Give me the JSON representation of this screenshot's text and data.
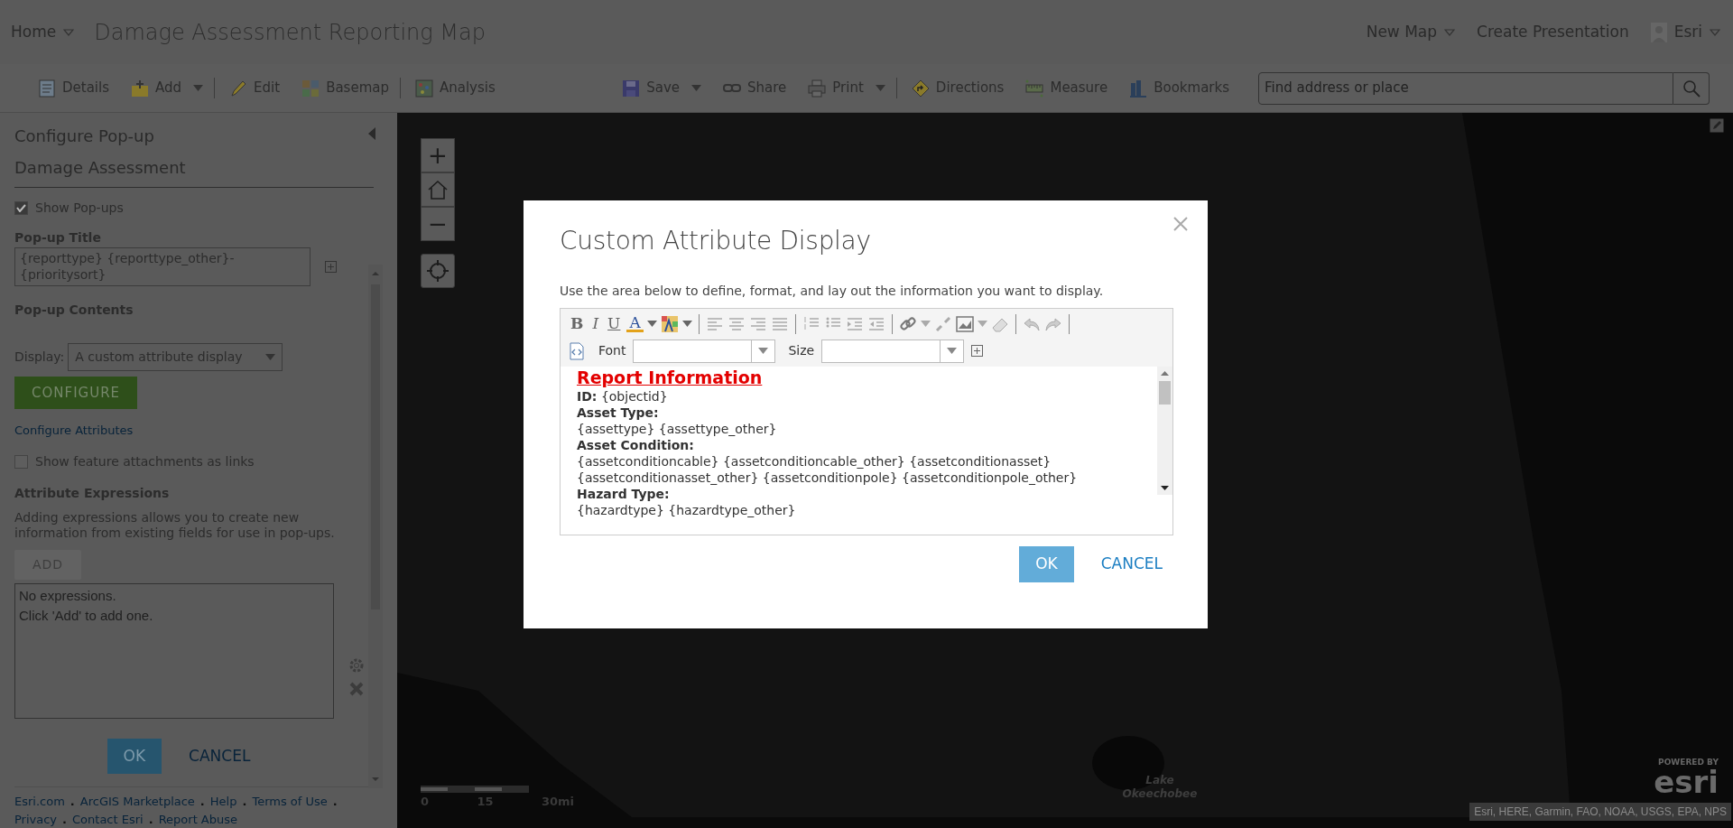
{
  "header": {
    "home": "Home",
    "title": "Damage Assessment Reporting Map",
    "links": [
      {
        "label": "New Map",
        "dropdown": true
      },
      {
        "label": "Create Presentation",
        "dropdown": false
      }
    ],
    "user": "Esri"
  },
  "toolbar": {
    "items": [
      {
        "kind": "details",
        "label": "Details",
        "dropdown": false,
        "divider_after": false
      },
      {
        "kind": "add",
        "label": "Add",
        "dropdown": true,
        "divider_after": true
      },
      {
        "kind": "edit",
        "label": "Edit",
        "dropdown": false,
        "divider_after": false
      },
      {
        "kind": "basemap",
        "label": "Basemap",
        "dropdown": false,
        "divider_after": true
      },
      {
        "kind": "analysis",
        "label": "Analysis",
        "dropdown": false,
        "divider_after": false
      },
      {
        "kind": "spacer"
      },
      {
        "kind": "save",
        "label": "Save",
        "dropdown": true,
        "divider_after": false
      },
      {
        "kind": "share",
        "label": "Share",
        "dropdown": false,
        "divider_after": false
      },
      {
        "kind": "print",
        "label": "Print",
        "dropdown": true,
        "divider_after": true
      },
      {
        "kind": "directions",
        "label": "Directions",
        "dropdown": false,
        "divider_after": false
      },
      {
        "kind": "measure",
        "label": "Measure",
        "dropdown": false,
        "divider_after": false
      },
      {
        "kind": "bookmarks",
        "label": "Bookmarks",
        "dropdown": false,
        "divider_after": false
      }
    ],
    "search": {
      "placeholder": "Find address or place"
    }
  },
  "left_panel": {
    "title": "Configure Pop-up",
    "layer": "Damage Assessment",
    "show_popups": {
      "label": "Show Pop-ups",
      "checked": true
    },
    "popup_title": {
      "label": "Pop-up Title",
      "value": "{reporttype} {reporttype_other}-{prioritysort}"
    },
    "contents_label": "Pop-up Contents",
    "display": {
      "label": "Display:",
      "value": "A custom attribute display"
    },
    "configure_button": "CONFIGURE",
    "configure_link": "Configure Attributes",
    "show_attachments": {
      "label": "Show feature attachments as links",
      "checked": false
    },
    "expressions": {
      "heading": "Attribute Expressions",
      "description": "Adding expressions allows you to create new information from existing fields for use in pop-ups.",
      "add_button": "ADD",
      "list_lines": [
        "No expressions.",
        "Click 'Add' to add one."
      ]
    },
    "ok": "OK",
    "cancel": "CANCEL",
    "footer_separator": ".",
    "footer_links": [
      "Esri.com",
      "ArcGIS Marketplace",
      "Help",
      "Terms of Use",
      "Privacy",
      "Contact Esri",
      "Report Abuse"
    ]
  },
  "map": {
    "zoom_in": "+",
    "zoom_out": "−",
    "scale_labels": [
      "0",
      "15",
      "30mi"
    ],
    "lake_label": "Lake Okeechobee",
    "attribution": "Esri, HERE, Garmin, FAO, NOAA, USGS, EPA, NPS",
    "powered_by": "POWERED BY",
    "logo": "esri"
  },
  "modal": {
    "title": "Custom Attribute Display",
    "description": "Use the area below to define, format, and lay out the information you want to display.",
    "format_buttons": [
      "B",
      "I",
      "U",
      "A"
    ],
    "font_label": "Font",
    "size_label": "Size",
    "lines": [
      {
        "kind": "heading",
        "text": "Report Information"
      },
      {
        "kind": "value",
        "text": "**ID:** {objectid}"
      },
      {
        "kind": "label",
        "text": "Asset Type:"
      },
      {
        "kind": "value",
        "text": "{assettype} {assettype_other}"
      },
      {
        "kind": "label",
        "text": "Asset Condition:"
      },
      {
        "kind": "value",
        "text": "{assetconditioncable} {assetconditioncable_other} {assetconditionasset} {assetconditionasset_other} {assetconditionpole} {assetconditionpole_other}"
      },
      {
        "kind": "label",
        "text": "Hazard Type:"
      },
      {
        "kind": "value",
        "text": "{hazardtype} {hazardtype_other}"
      }
    ],
    "ok": "OK",
    "cancel": "CANCEL"
  }
}
